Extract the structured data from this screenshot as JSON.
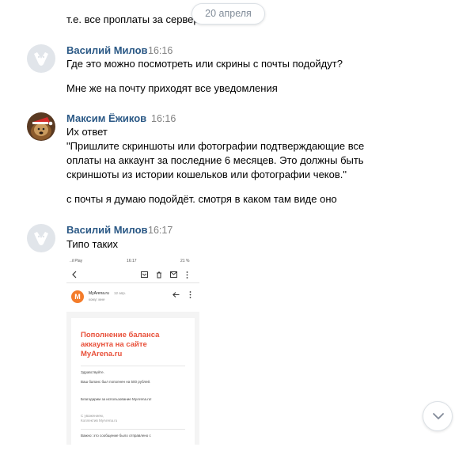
{
  "date_separator": "20 апреля",
  "previous_text": "т.е. все проплаты за сервер",
  "messages": [
    {
      "author": "Василий Милов",
      "time": "16:16",
      "lines": [
        "Где это можно посмотреть или скрины с почты подойдут?",
        "Мне же на почту приходят все уведомления"
      ]
    },
    {
      "author": "Максим Ёжиков",
      "time": "16:16",
      "lines": [
        "Их ответ",
        "\"Пришлите скриншоты или фотографии подтверждающие все",
        "оплаты на аккаунт за последние 6 месяцев. Это должны быть",
        "скриншоты из истории кошельков или фотографии чеков.\"",
        "с почты я думаю подойдёт. смотря в каком там виде оно"
      ]
    },
    {
      "author": "Василий Милов",
      "time": "16:17",
      "lines": [
        "Типо таких"
      ]
    }
  ],
  "attachment": {
    "status_left": "..il Play",
    "status_time": "16:17",
    "status_battery": "21 %",
    "sender_initial": "M",
    "sender_name": "MyArena.ru",
    "sender_date": "12 апр.",
    "sender_to": "кому: мне",
    "heading": "Пополнение баланса аккаунта на сайте MyArena.ru",
    "greeting": "Здравствуйте.",
    "line1": "Ваш баланс был пополнен на 500 рублей.",
    "line2": "Благодарим за использование MyArena.ru!",
    "regards": "С уважением,",
    "team": "Коллектив MyArena.ru",
    "footer": "Важно: это сообщение было отправлено с"
  },
  "colors": {
    "author": "#2a5885",
    "accent_orange": "#f47c2a",
    "heading_red": "#e8503a"
  }
}
